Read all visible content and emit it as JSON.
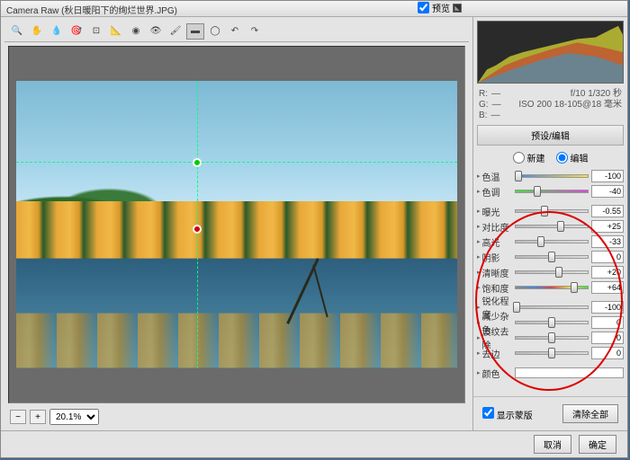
{
  "title": "Camera Raw (秋日暖阳下的绚烂世界.JPG)",
  "tools": [
    "zoom",
    "hand",
    "eyedropper",
    "sampler",
    "crop",
    "straighten",
    "spot",
    "redeye",
    "brush",
    "gradient",
    "radial",
    "rotate-ccw",
    "rotate-cw"
  ],
  "preview_label": "预览",
  "zoom": {
    "minus": "−",
    "plus": "+",
    "value": "20.1%"
  },
  "info": {
    "r": "R:",
    "r_val": "—",
    "f": "f/10  1/320 秒",
    "g": "G:",
    "g_val": "—",
    "iso": "ISO 200  18-105@18 毫米",
    "b": "B:",
    "b_val": "—"
  },
  "panel_title": "预设/编辑",
  "radios": {
    "new": "新建",
    "edit": "编辑"
  },
  "sliders": [
    {
      "k": "temp",
      "label": "色温",
      "val": "-100",
      "pos": 5,
      "bar": "temp"
    },
    {
      "k": "tint",
      "label": "色调",
      "val": "-40",
      "pos": 30,
      "bar": "tint",
      "gap": false
    },
    {
      "k": "exposure",
      "label": "曝光",
      "val": "-0.55",
      "pos": 40,
      "gap": true
    },
    {
      "k": "contrast",
      "label": "对比度",
      "val": "+25",
      "pos": 62
    },
    {
      "k": "highlights",
      "label": "高光",
      "val": "-33",
      "pos": 35
    },
    {
      "k": "shadows",
      "label": "阴影",
      "val": "0",
      "pos": 50
    },
    {
      "k": "clarity",
      "label": "清晰度",
      "val": "+20",
      "pos": 60
    },
    {
      "k": "saturation",
      "label": "饱和度",
      "val": "+64",
      "pos": 80,
      "bar": "vib"
    },
    {
      "k": "sharpen",
      "label": "锐化程度",
      "val": "-100",
      "pos": 2,
      "gap": true
    },
    {
      "k": "noise-color",
      "label": "减少杂色",
      "val": "0",
      "pos": 50
    },
    {
      "k": "moire",
      "label": "波纹去除",
      "val": "0",
      "pos": 50
    },
    {
      "k": "defringe",
      "label": "去边",
      "val": "0",
      "pos": 50
    },
    {
      "k": "color",
      "label": "颜色",
      "val": "",
      "pos": null,
      "gap": true,
      "noval": true
    }
  ],
  "show_mask": "显示蒙版",
  "clear_all": "清除全部",
  "cancel": "取消",
  "ok": "确定"
}
